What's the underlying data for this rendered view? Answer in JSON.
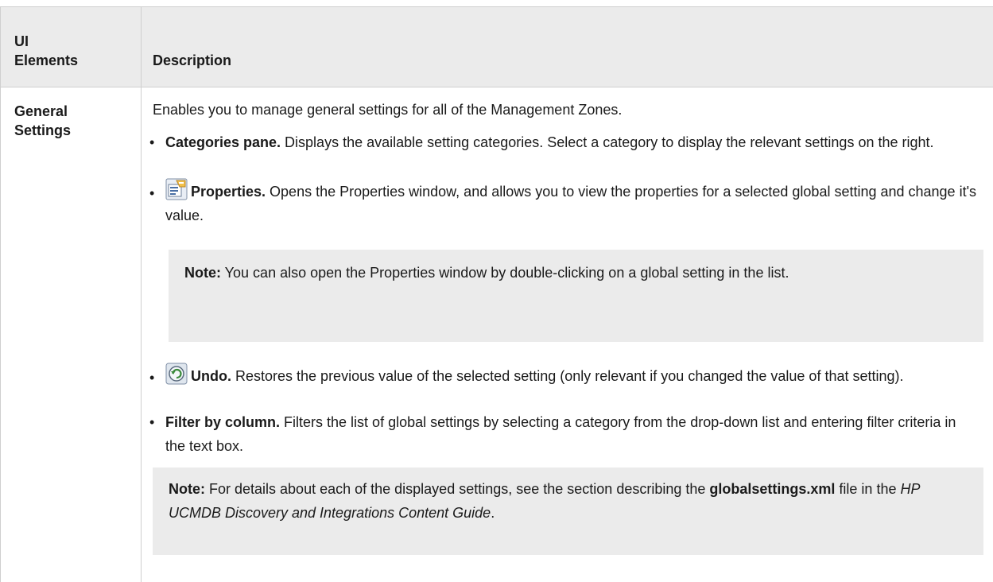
{
  "header": {
    "col_ui_line1": "UI",
    "col_ui_line2": "Elements",
    "col_description": "Description"
  },
  "row": {
    "label_line1": "General",
    "label_line2": "Settings",
    "intro": "Enables you to manage general settings for all of the Management Zones.",
    "bullets": [
      {
        "title": "Categories pane.",
        "text": " Displays the available setting categories. Select a category to display the relevant settings on the right.",
        "icon": null
      },
      {
        "title": "Properties.",
        "text": " Opens the Properties window, and allows you to view the properties for a selected global setting and change it's value.",
        "icon": "properties-icon"
      },
      {
        "title": "Undo.",
        "text": " Restores the previous value of the selected setting (only relevant if you changed the value of that setting).",
        "icon": "undo-icon"
      },
      {
        "title": "Filter by column.",
        "text": " Filters the list of global settings by selecting a category from the drop-down list and entering filter criteria in the text box.",
        "icon": null
      }
    ],
    "note1": {
      "label": "Note:",
      "text": " You can also open the Properties window by double-clicking on a global setting in the list."
    },
    "note2": {
      "label": "Note:",
      "text_before": " For details about each of the displayed settings, see the section describing the ",
      "filename": "globalsettings.xml",
      "text_middle": " file in the ",
      "guide": "HP UCMDB Discovery and Integrations Content Guide",
      "text_after": "."
    }
  },
  "colors": {
    "header_bg": "#ebebeb",
    "note_bg": "#ebebeb",
    "rule": "#cfcfcf"
  }
}
